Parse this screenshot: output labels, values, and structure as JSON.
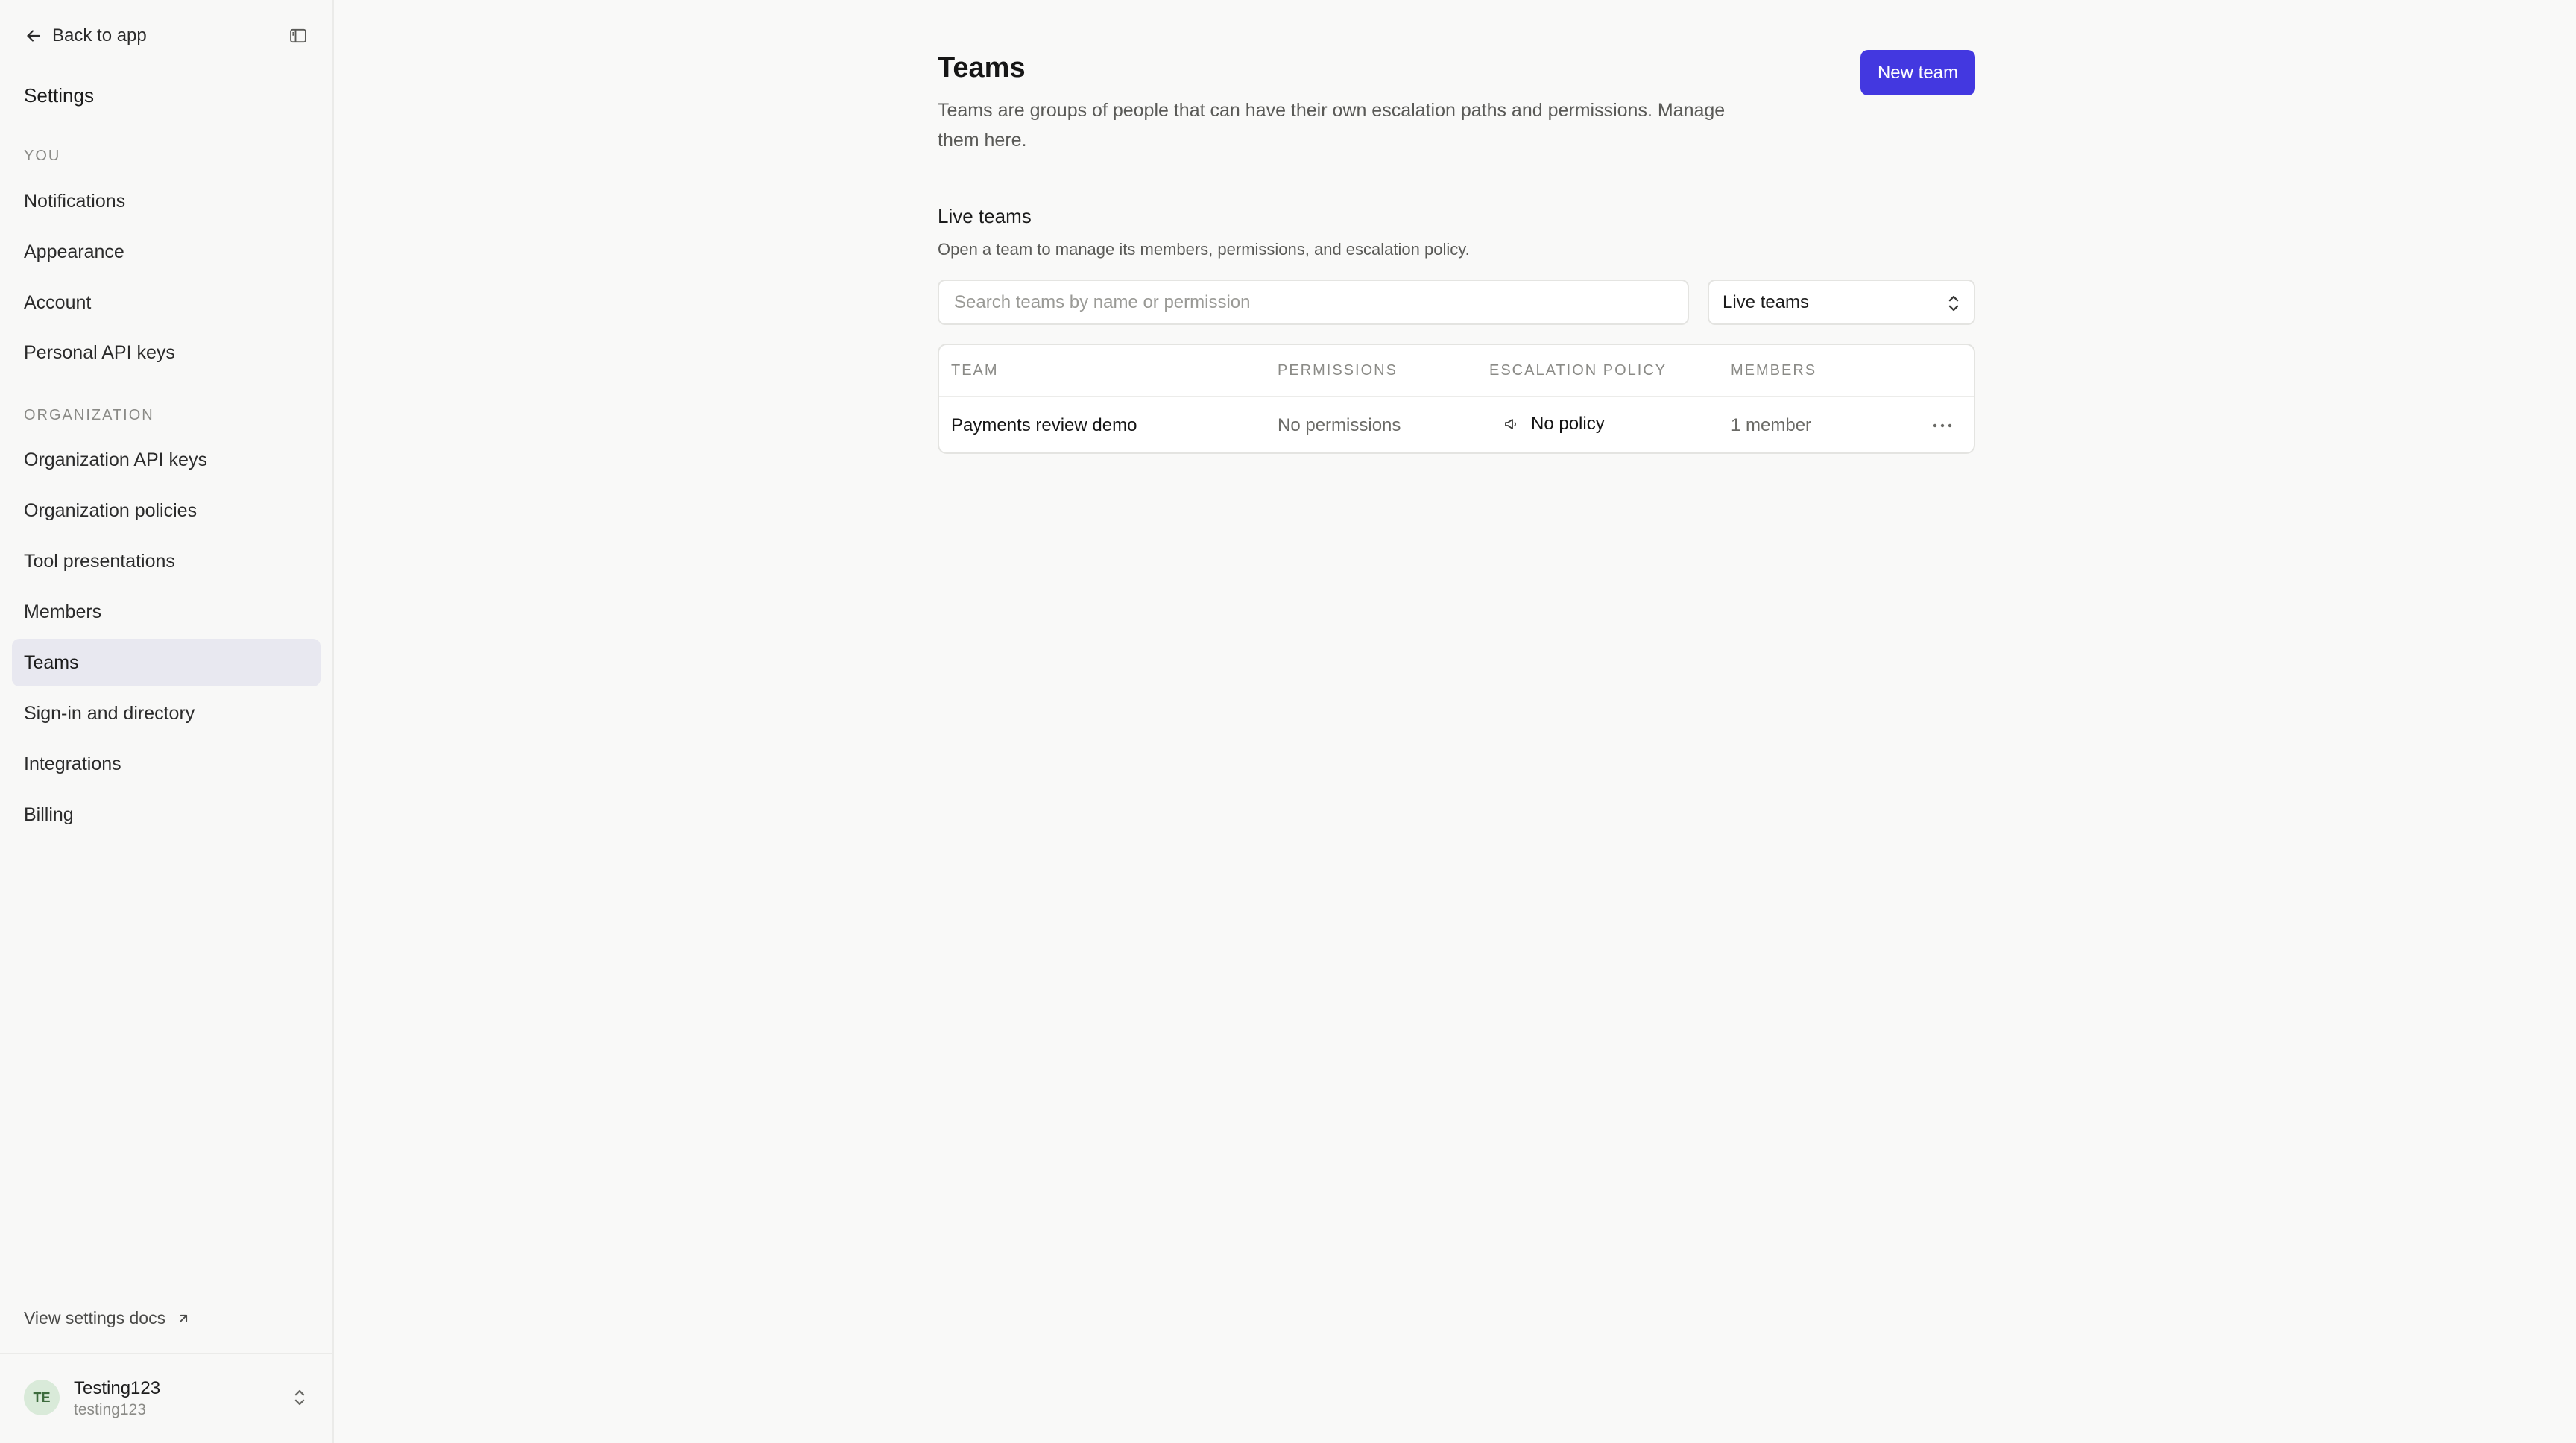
{
  "sidebar": {
    "back_label": "Back to app",
    "settings_title": "Settings",
    "section_you": "YOU",
    "you_items": [
      "Notifications",
      "Appearance",
      "Account",
      "Personal API keys"
    ],
    "section_org": "ORGANIZATION",
    "org_items": [
      "Organization API keys",
      "Organization policies",
      "Tool presentations",
      "Members",
      "Teams",
      "Sign-in and directory",
      "Integrations",
      "Billing"
    ],
    "active_item": "Teams",
    "docs_link": "View settings docs",
    "user": {
      "initials": "TE",
      "name": "Testing123",
      "handle": "testing123"
    }
  },
  "main": {
    "title": "Teams",
    "description": "Teams are groups of people that can have their own escalation paths and permissions. Manage them here.",
    "new_team_label": "New team",
    "section_title": "Live teams",
    "section_desc": "Open a team to manage its members, permissions, and escalation policy.",
    "search_placeholder": "Search teams by name or permission",
    "filter_value": "Live teams",
    "table": {
      "headers": [
        "TEAM",
        "PERMISSIONS",
        "ESCALATION POLICY",
        "MEMBERS"
      ],
      "rows": [
        {
          "team": "Payments review demo",
          "permissions": "No permissions",
          "policy": "No policy",
          "members": "1 member"
        }
      ]
    }
  },
  "colors": {
    "accent": "#4338e0",
    "active_nav_bg": "#e8e8f0",
    "avatar_bg": "#d9ead9"
  },
  "icons": {
    "back": "arrow-left-icon",
    "collapse": "sidebar-toggle-icon",
    "docs": "arrow-up-right-icon",
    "account_switch": "chevron-up-down-icon",
    "select": "chevron-up-down-icon",
    "policy": "megaphone-icon",
    "row_menu": "ellipsis-icon"
  }
}
